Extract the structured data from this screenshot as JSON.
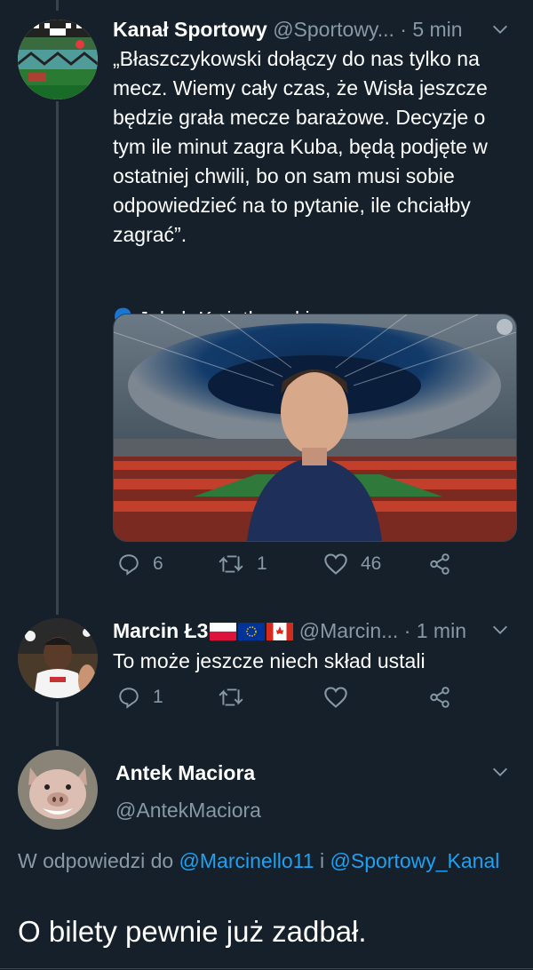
{
  "tweets": [
    {
      "name": "Kanał Sportowy",
      "handle": "@Sportowy...",
      "time": "· 5 min",
      "text": "„Błaszczykowski dołączy do nas tylko na mecz. Wiemy cały czas, że Wisła jeszcze będzie grała mecze barażowe. Decyzje o tym ile minut zagra Kuba, będą podjęte w ostatniej chwili, bo on sam musi sobie odpowiedzieć na to pytanie, ile chciałby zagrać”.",
      "author_line": "🗣️Jakub Kwiatkowski",
      "replies": "6",
      "retweets": "1",
      "likes": "46"
    },
    {
      "name": "Marcin Ł3",
      "handle": "@Marcin...",
      "time": "· 1 min",
      "text": "To może jeszcze niech skład ustali",
      "replies": "1",
      "retweets": "",
      "likes": ""
    }
  ],
  "focused": {
    "name": "Antek Maciora",
    "handle": "@AntekMaciora",
    "reply_prefix": "W odpowiedzi do",
    "mention_1": "@Marcinello11",
    "conjunction": "i",
    "mention_2": "@Sportowy_Kanal",
    "text": "O bilety pewnie już zadbał."
  },
  "colors": {
    "background": "#15202b",
    "secondary_text": "#8899a6",
    "link": "#1da1f2",
    "divider": "#38444d"
  },
  "icons": [
    "reply-icon",
    "retweet-icon",
    "like-icon",
    "share-icon",
    "chevron-down-icon",
    "speaking-head-icon"
  ]
}
